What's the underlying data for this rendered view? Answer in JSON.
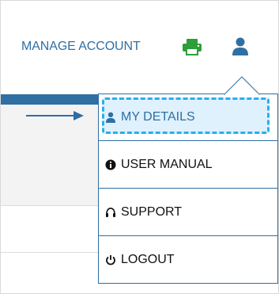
{
  "header": {
    "manage_account_label": "MANAGE ACCOUNT",
    "print_icon": "printer-icon",
    "user_icon": "user-icon"
  },
  "dropdown": {
    "items": [
      {
        "label": "MY DETAILS",
        "icon": "user-icon",
        "highlighted": true
      },
      {
        "label": "USER MANUAL",
        "icon": "info-circle-icon"
      },
      {
        "label": "SUPPORT",
        "icon": "headphones-icon"
      },
      {
        "label": "LOGOUT",
        "icon": "power-icon"
      }
    ]
  },
  "colors": {
    "brand_blue": "#2f6fa3",
    "print_green": "#2e9e3a",
    "highlight_border": "#29aef0",
    "highlight_fill": "#dff1fc"
  }
}
